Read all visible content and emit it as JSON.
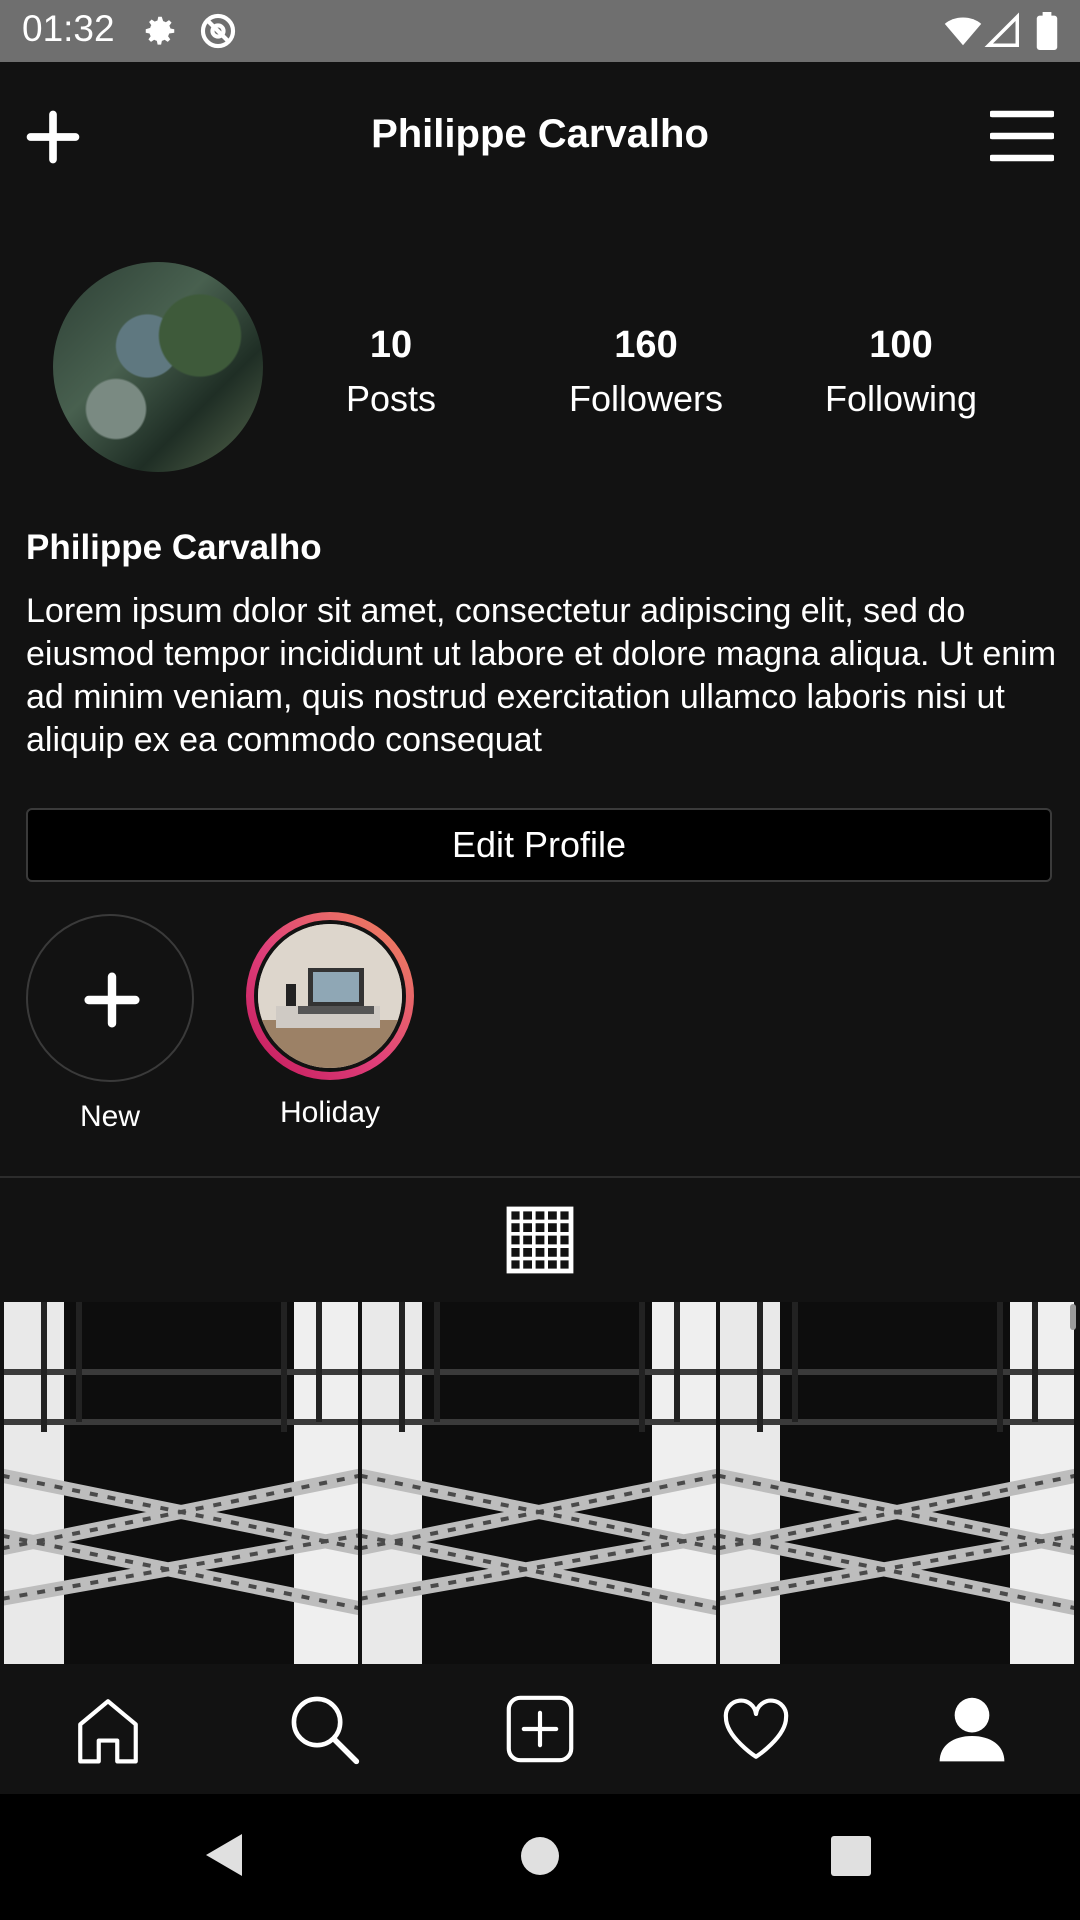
{
  "status_bar": {
    "time": "01:32",
    "icons": [
      "gear-icon",
      "at-sign-icon",
      "wifi-icon",
      "signal-icon",
      "battery-icon"
    ]
  },
  "app_bar": {
    "title": "Philippe Carvalho",
    "left_icon": "plus-icon",
    "right_icon": "menu-icon"
  },
  "profile": {
    "name": "Philippe Carvalho",
    "bio": "Lorem ipsum dolor sit amet, consectetur adipiscing elit, sed do eiusmod tempor incididunt ut labore et dolore magna aliqua. Ut enim ad minim veniam, quis nostrud exercitation ullamco laboris nisi ut aliquip ex ea commodo consequat",
    "stats": [
      {
        "value": "10",
        "label": "Posts"
      },
      {
        "value": "160",
        "label": "Followers"
      },
      {
        "value": "100",
        "label": "Following"
      }
    ],
    "edit_button": "Edit Profile"
  },
  "highlights": [
    {
      "label": "New",
      "icon": "plus-icon"
    },
    {
      "label": "Holiday"
    }
  ],
  "grid_tab_icon": "grid-icon",
  "bottom_nav": [
    "home-icon",
    "search-icon",
    "add-post-icon",
    "heart-icon",
    "profile-icon"
  ],
  "colors": {
    "background": "#121212",
    "status_bar": "#6f6f6f",
    "highlight_ring_start": "#c2185b",
    "highlight_ring_end": "#f08a5a"
  }
}
